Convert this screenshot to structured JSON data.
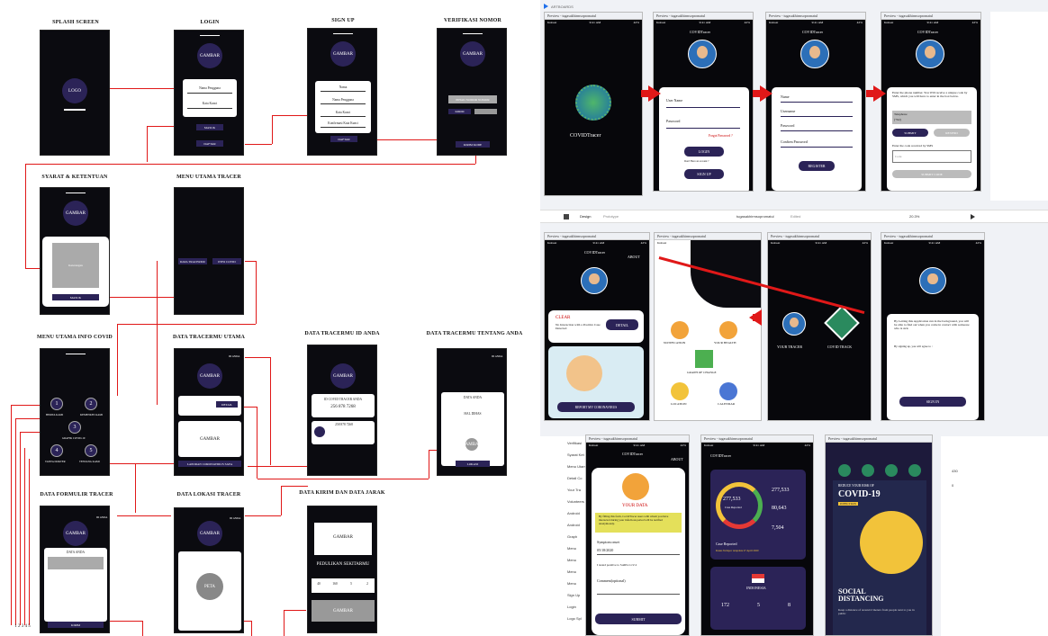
{
  "wireframes": {
    "splash": {
      "title": "SPLASH SCREEN",
      "logo": "LOGO"
    },
    "login": {
      "title": "LOGIN",
      "gambar": "GAMBAR",
      "user": "Nama Pengguna",
      "pass": "Kata Kunci",
      "masuk": "MASUK",
      "daftar": "DAFTAR"
    },
    "signup": {
      "title": "SIGN UP",
      "gambar": "GAMBAR",
      "nama": "Nama",
      "user": "Nama Pengguna",
      "pass": "Kata Kunci",
      "confirm": "Konfirmasi Kata Kunci",
      "daftar": "DAFTAR"
    },
    "verif": {
      "title": "VERIFIKASI NOMOR",
      "gambar": "GAMBAR",
      "field": "PIHAK NOMOR NOMOR",
      "kirim": "KIRIM",
      "kirim_kode": "KIRIM KODE"
    },
    "syarat": {
      "title": "SYARAT & KETENTUAN",
      "gambar": "GAMBAR",
      "ket": "Keterangan",
      "masuk": "MASUK"
    },
    "menu_tracer": {
      "title": "MENU UTAMA TRACER",
      "a": "DATA TRACERMU",
      "b": "INFO COVID"
    },
    "menu_info": {
      "title": "MENU UTAMA INFO COVID",
      "items": [
        "BERITA KAMI",
        "KEMENKES KAMI",
        "GRAFIK COVID-19",
        "TANYA DOKTER",
        "TENTANG KAMI"
      ],
      "nums": [
        "1",
        "2",
        "3",
        "4",
        "5"
      ]
    },
    "tracermu": {
      "title": "DATA TRACERMU UTAMA",
      "gambar": "GAMBAR",
      "anda": "ID ANDA",
      "detail": "DETAIL",
      "gambar2": "GAMBAR",
      "laporan": "LAPORAN CORONAVIRUS SAYA"
    },
    "tracermu_id": {
      "title": "DATA TRACERMU ID ANDA",
      "gambar": "GAMBAR",
      "id": "ID COVID TRACER ANDA",
      "num": "256 878 7268",
      "ph": "258 878 7268"
    },
    "tracermu_tentang": {
      "title": "DATA TRACERMU TENTANG ANDA",
      "anda": "ID ANDA",
      "data": "DATA ANDA",
      "hasil": "HAL DIHAS",
      "gambar": "GAMBAR",
      "lokasi": "LOKASI"
    },
    "formulir": {
      "title": "DATA FORMULIR TRACER",
      "gambar": "GAMBAR",
      "anda": "ID ANDA",
      "data": "DATA ANDA",
      "kirim": "KIRIM"
    },
    "lokasi": {
      "title": "DATA LOKASI TRACER",
      "gambar": "GAMBAR",
      "anda": "ID ANDA",
      "peta": "PETA"
    },
    "kirim": {
      "title": "DATA KIRIM DAN DATA JARAK",
      "gambar": "GAMBAR",
      "pedulikan": "PEDULIKAN SEKITARMU",
      "stats": [
        "40",
        "160",
        "5",
        "2"
      ],
      "gambar2": "GAMBAR"
    },
    "footer_nums": "1 2 3 4 5"
  },
  "editor": {
    "artboards": "ARTBOARDS",
    "tab_design": "Design",
    "tab_proto": "Prototype",
    "doc": "tugasakhirmsopromatul",
    "status": "Edited",
    "zoom": "20.3%",
    "layers": [
      "Verifikasi",
      "Syarat Ket",
      "Menu Utam",
      "Detail Co",
      "Your Tra",
      "Volunteers",
      "Android",
      "Android",
      "Graph",
      "Menu",
      "Menu",
      "Menu",
      "Menu",
      "Sign Up",
      "Login",
      "Logo Spl"
    ]
  },
  "screens": {
    "preview": "Preview - tugasakhirmsopromatul",
    "time": "9:41 AM",
    "carrier": "Indosat",
    "battery": "42%",
    "app_name": "COVIDTracer",
    "login": {
      "user": "User Name",
      "pass": "Password",
      "forgot": "Forgot Password ?",
      "login": "LOGIN",
      "noacc": "Don't Have an account ?",
      "signup": "SIGN UP"
    },
    "register": {
      "name": "Name",
      "user": "Username",
      "pass": "Password",
      "confirm": "Confirm Password",
      "reg": "REGISTER"
    },
    "verify": {
      "desc": "Enter the phone number. You Will receive a unique code by SMS, which you will have to enter in the box below.",
      "phone": "Telephone",
      "code": "(+62)",
      "submit": "SUBMIT",
      "resend": "RESEND",
      "enter": "Enter the code received by SMS",
      "codeph": "Code",
      "submit_code": "SUBMIT CODE"
    },
    "about": {
      "about": "ABOUT",
      "clear": "CLEAR",
      "clear_desc": "No Interaction with a Positive Case Detected",
      "detail": "DETAIL",
      "report": "REPORT MY CORONAVIRUS"
    },
    "menu": {
      "notif": "NOTIFICATION",
      "health": "YOUR HEALTH",
      "graph": "GRAPH OF CHANGE",
      "location": "LOCATION",
      "calendar": "CALENDAR"
    },
    "track": {
      "tracer": "YOUR TRACER",
      "covid": "COVID TRACK"
    },
    "bg": {
      "desc": "By Letting this Application run in the background, you will be able to find out when you come in contact with someone who is sick",
      "agree": "By signing up, you will agree to :",
      "signin": "SIGN IN"
    },
    "data": {
      "title": "YOUR DATA",
      "desc": "By filling this form, CovidTracer users with whom you have interacted during your infectious period will be notified anonymously.",
      "onset": "Symptom onset",
      "date": "05/18/2020",
      "tested": "I tested positive to SARS-CoV-2",
      "comment": "Comment(optional)",
      "submit": "SUBMIT"
    },
    "stats": {
      "total": "277,533",
      "label": "Case Reported",
      "v1": "277,533",
      "v2": "80,643",
      "v3": "7,504",
      "reported": "Case Reported",
      "date": "Kasus Terlapor terupdate 27 April 2020",
      "country": "INDONESIA",
      "c1": "172",
      "c2": "5",
      "c3": "8"
    },
    "poster": {
      "top": "REDUCE YOUR RISK OF",
      "big": "COVID-19",
      "infection": "INFECTION",
      "social": "SOCIAL DISTANCING",
      "keep": "Keep a distance of around 2 meters from people next to you in public"
    },
    "props": {
      "v1": "430",
      "v2": "0"
    }
  }
}
